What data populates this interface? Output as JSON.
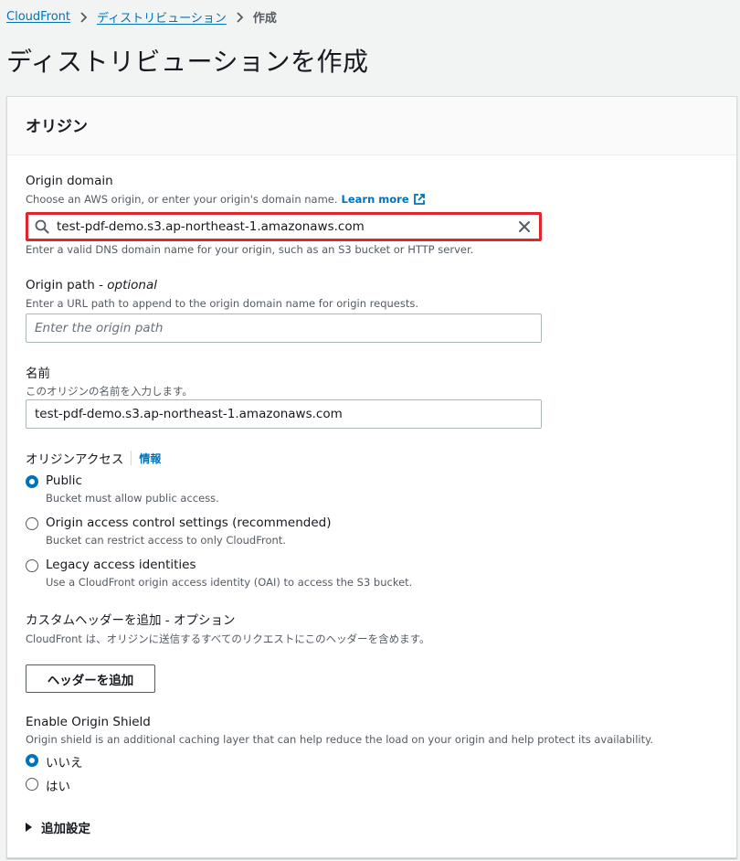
{
  "breadcrumb": {
    "item1": "CloudFront",
    "item2": "ディストリビューション",
    "current": "作成"
  },
  "page_title": "ディストリビューションを作成",
  "panel": {
    "header": "オリジン",
    "origin_domain": {
      "label": "Origin domain",
      "desc": "Choose an AWS origin, or enter your origin's domain name.",
      "learn_more": "Learn more",
      "value": "test-pdf-demo.s3.ap-northeast-1.amazonaws.com",
      "help": "Enter a valid DNS domain name for your origin, such as an S3 bucket or HTTP server."
    },
    "origin_path": {
      "label": "Origin path",
      "label_suffix": "optional",
      "desc": "Enter a URL path to append to the origin domain name for origin requests.",
      "placeholder": "Enter the origin path"
    },
    "name": {
      "label": "名前",
      "desc": "このオリジンの名前を入力します。",
      "value": "test-pdf-demo.s3.ap-northeast-1.amazonaws.com"
    },
    "origin_access": {
      "label": "オリジンアクセス",
      "info": "情報",
      "options": [
        {
          "label": "Public",
          "desc": "Bucket must allow public access.",
          "checked": true
        },
        {
          "label": "Origin access control settings (recommended)",
          "desc": "Bucket can restrict access to only CloudFront.",
          "checked": false
        },
        {
          "label": "Legacy access identities",
          "desc": "Use a CloudFront origin access identity (OAI) to access the S3 bucket.",
          "checked": false
        }
      ]
    },
    "custom_headers": {
      "label": "カスタムヘッダーを追加 - オプション",
      "desc": "CloudFront は、オリジンに送信するすべてのリクエストにこのヘッダーを含めます。",
      "button": "ヘッダーを追加"
    },
    "origin_shield": {
      "label": "Enable Origin Shield",
      "desc": "Origin shield is an additional caching layer that can help reduce the load on your origin and help protect its availability.",
      "options": [
        {
          "label": "いいえ",
          "checked": true
        },
        {
          "label": "はい",
          "checked": false
        }
      ]
    },
    "additional_settings": "追加設定"
  },
  "colors": {
    "link": "#0073bb",
    "highlight_border": "#e0262b",
    "radio_checked": "#0073bb"
  }
}
